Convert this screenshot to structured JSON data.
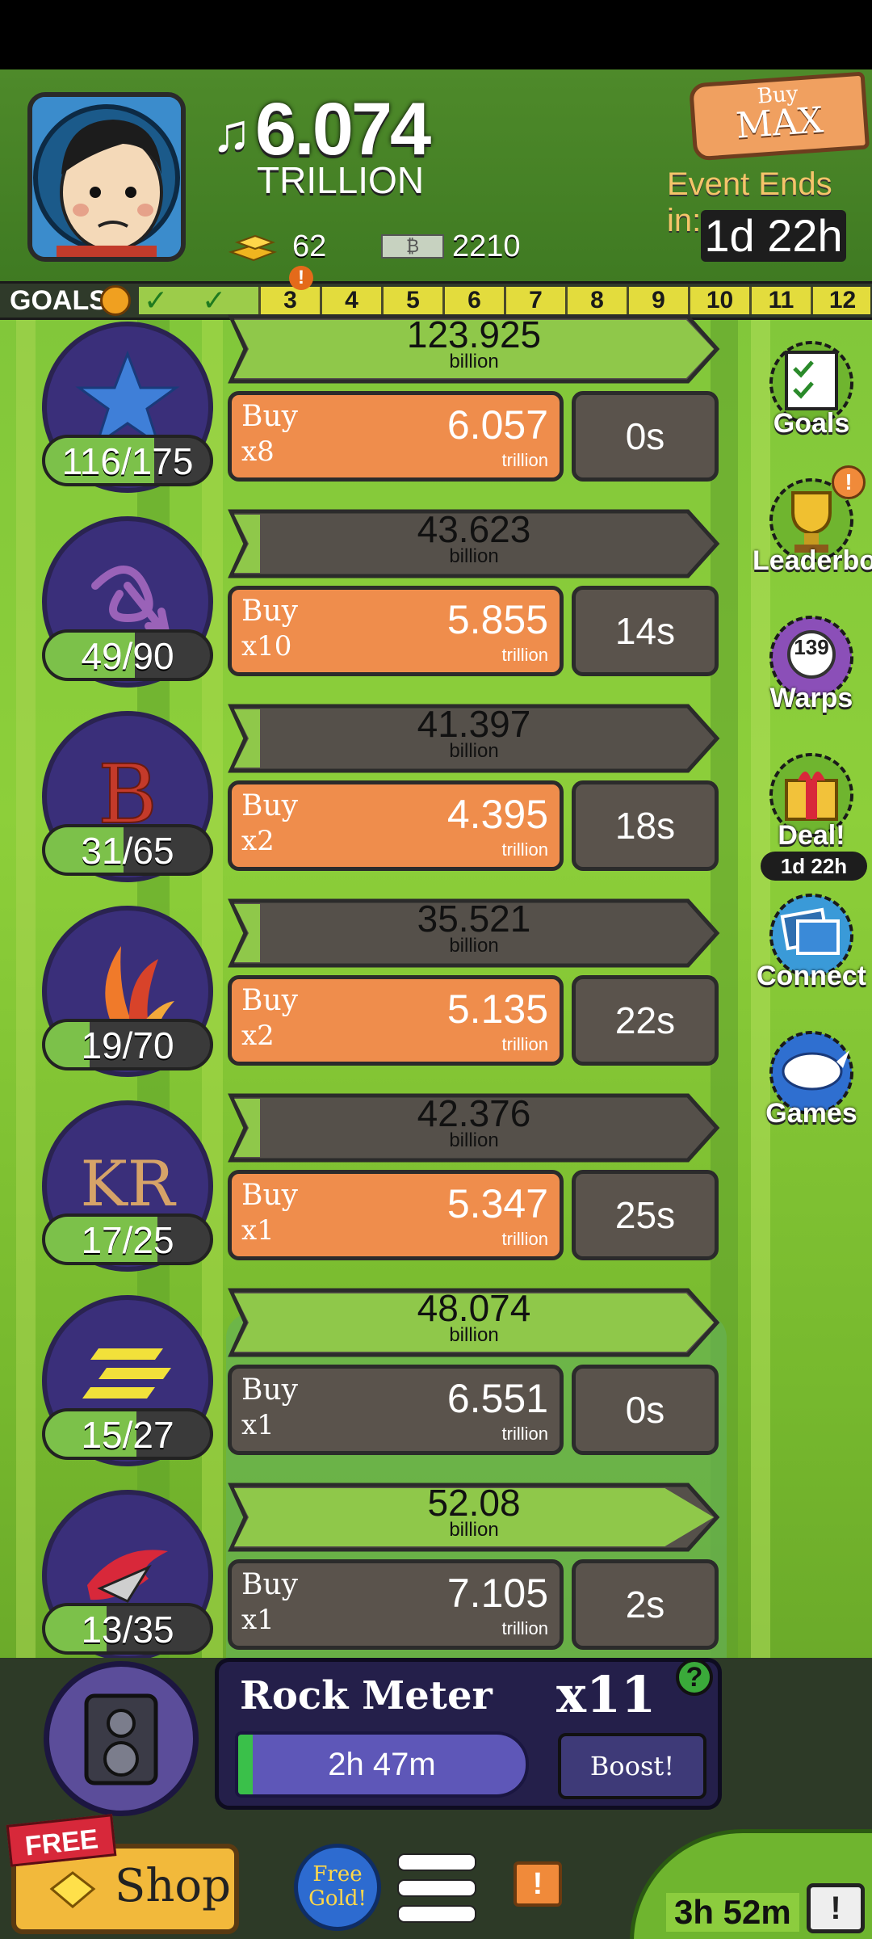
{
  "header": {
    "money_value": "6.074",
    "money_unit": "TRILLION",
    "gold_count": "62",
    "cash_count": "2210",
    "buy_max_top": "Buy",
    "buy_max_bottom": "MAX",
    "event_label": "Event Ends in:",
    "event_time": "1d 22h"
  },
  "goals": {
    "label": "GOALS",
    "cells": [
      "3",
      "4",
      "5",
      "6",
      "7",
      "8",
      "9",
      "10",
      "11",
      "12"
    ],
    "alert": "!"
  },
  "businesses": [
    {
      "count": "116/175",
      "progress_value": "123.925",
      "progress_unit": "billion",
      "progress_fraction": 1.0,
      "buy_label": "Buy",
      "buy_mult": "x8",
      "price": "6.057",
      "price_unit": "trillion",
      "timer": "0s",
      "affordable": true,
      "icon": "star-icon"
    },
    {
      "count": "49/90",
      "progress_value": "43.623",
      "progress_unit": "billion",
      "progress_fraction": 0.07,
      "buy_label": "Buy",
      "buy_mult": "x10",
      "price": "5.855",
      "price_unit": "trillion",
      "timer": "14s",
      "affordable": true,
      "icon": "swirl-glyph-icon"
    },
    {
      "count": "31/65",
      "progress_value": "41.397",
      "progress_unit": "billion",
      "progress_fraction": 0.06,
      "buy_label": "Buy",
      "buy_mult": "x2",
      "price": "4.395",
      "price_unit": "trillion",
      "timer": "18s",
      "affordable": true,
      "icon": "letter-b-icon"
    },
    {
      "count": "19/70",
      "progress_value": "35.521",
      "progress_unit": "billion",
      "progress_fraction": 0.05,
      "buy_label": "Buy",
      "buy_mult": "x2",
      "price": "5.135",
      "price_unit": "trillion",
      "timer": "22s",
      "affordable": true,
      "icon": "flame-icon"
    },
    {
      "count": "17/25",
      "progress_value": "42.376",
      "progress_unit": "billion",
      "progress_fraction": 0.04,
      "buy_label": "Buy",
      "buy_mult": "x1",
      "price": "5.347",
      "price_unit": "trillion",
      "timer": "25s",
      "affordable": true,
      "icon": "kr-logo-icon"
    },
    {
      "count": "15/27",
      "progress_value": "48.074",
      "progress_unit": "billion",
      "progress_fraction": 1.0,
      "buy_label": "Buy",
      "buy_mult": "x1",
      "price": "6.551",
      "price_unit": "trillion",
      "timer": "0s",
      "affordable": false,
      "icon": "stripes-icon"
    },
    {
      "count": "13/35",
      "progress_value": "52.08",
      "progress_unit": "billion",
      "progress_fraction": 0.95,
      "buy_label": "Buy",
      "buy_mult": "x1",
      "price": "7.105",
      "price_unit": "trillion",
      "timer": "2s",
      "affordable": false,
      "icon": "s-logo-icon"
    }
  ],
  "side_buttons": [
    {
      "label": "Goals",
      "icon": "checklist-icon"
    },
    {
      "label": "Leaderboard",
      "icon": "trophy-icon",
      "alert": "!"
    },
    {
      "label": "Warps",
      "icon": "warp-icon",
      "badge": "139"
    },
    {
      "label": "Deal!",
      "icon": "gift-icon",
      "sub": "1d 22h"
    },
    {
      "label": "Connect",
      "icon": "cards-icon"
    },
    {
      "label": "Games",
      "icon": "rhino-icon"
    }
  ],
  "rock_meter": {
    "title": "Rock Meter",
    "multiplier": "x11",
    "time": "2h 47m",
    "boost": "Boost!",
    "help": "?",
    "fill_fraction": 0.05
  },
  "bottom": {
    "free_tag": "FREE",
    "shop": "Shop",
    "free_gold": "Free Gold!",
    "alert": "!",
    "tv_time": "3h 52m",
    "tv_alert": "!"
  }
}
